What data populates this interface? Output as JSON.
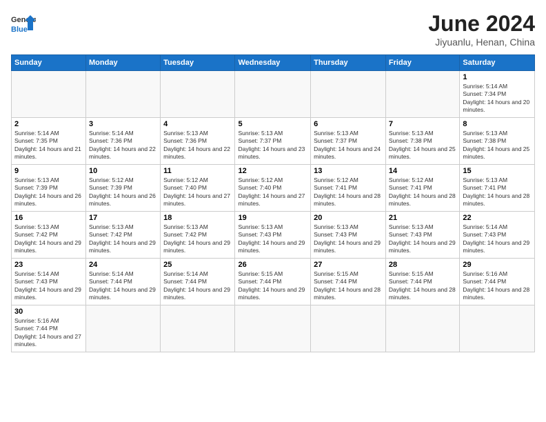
{
  "header": {
    "logo": {
      "line1": "General",
      "line2": "Blue"
    },
    "title": "June 2024",
    "subtitle": "Jiyuanlu, Henan, China"
  },
  "weekdays": [
    "Sunday",
    "Monday",
    "Tuesday",
    "Wednesday",
    "Thursday",
    "Friday",
    "Saturday"
  ],
  "weeks": [
    [
      {
        "day": null
      },
      {
        "day": null
      },
      {
        "day": null
      },
      {
        "day": null
      },
      {
        "day": null
      },
      {
        "day": null
      },
      {
        "day": 1,
        "sunrise": "5:14 AM",
        "sunset": "7:34 PM",
        "daylight": "14 hours and 20 minutes."
      }
    ],
    [
      {
        "day": 2,
        "sunrise": "5:14 AM",
        "sunset": "7:35 PM",
        "daylight": "14 hours and 21 minutes."
      },
      {
        "day": 3,
        "sunrise": "5:14 AM",
        "sunset": "7:36 PM",
        "daylight": "14 hours and 22 minutes."
      },
      {
        "day": 4,
        "sunrise": "5:13 AM",
        "sunset": "7:36 PM",
        "daylight": "14 hours and 22 minutes."
      },
      {
        "day": 5,
        "sunrise": "5:13 AM",
        "sunset": "7:37 PM",
        "daylight": "14 hours and 23 minutes."
      },
      {
        "day": 6,
        "sunrise": "5:13 AM",
        "sunset": "7:37 PM",
        "daylight": "14 hours and 24 minutes."
      },
      {
        "day": 7,
        "sunrise": "5:13 AM",
        "sunset": "7:38 PM",
        "daylight": "14 hours and 25 minutes."
      },
      {
        "day": 8,
        "sunrise": "5:13 AM",
        "sunset": "7:38 PM",
        "daylight": "14 hours and 25 minutes."
      }
    ],
    [
      {
        "day": 9,
        "sunrise": "5:13 AM",
        "sunset": "7:39 PM",
        "daylight": "14 hours and 26 minutes."
      },
      {
        "day": 10,
        "sunrise": "5:12 AM",
        "sunset": "7:39 PM",
        "daylight": "14 hours and 26 minutes."
      },
      {
        "day": 11,
        "sunrise": "5:12 AM",
        "sunset": "7:40 PM",
        "daylight": "14 hours and 27 minutes."
      },
      {
        "day": 12,
        "sunrise": "5:12 AM",
        "sunset": "7:40 PM",
        "daylight": "14 hours and 27 minutes."
      },
      {
        "day": 13,
        "sunrise": "5:12 AM",
        "sunset": "7:41 PM",
        "daylight": "14 hours and 28 minutes."
      },
      {
        "day": 14,
        "sunrise": "5:12 AM",
        "sunset": "7:41 PM",
        "daylight": "14 hours and 28 minutes."
      },
      {
        "day": 15,
        "sunrise": "5:13 AM",
        "sunset": "7:41 PM",
        "daylight": "14 hours and 28 minutes."
      }
    ],
    [
      {
        "day": 16,
        "sunrise": "5:13 AM",
        "sunset": "7:42 PM",
        "daylight": "14 hours and 29 minutes."
      },
      {
        "day": 17,
        "sunrise": "5:13 AM",
        "sunset": "7:42 PM",
        "daylight": "14 hours and 29 minutes."
      },
      {
        "day": 18,
        "sunrise": "5:13 AM",
        "sunset": "7:42 PM",
        "daylight": "14 hours and 29 minutes."
      },
      {
        "day": 19,
        "sunrise": "5:13 AM",
        "sunset": "7:43 PM",
        "daylight": "14 hours and 29 minutes."
      },
      {
        "day": 20,
        "sunrise": "5:13 AM",
        "sunset": "7:43 PM",
        "daylight": "14 hours and 29 minutes."
      },
      {
        "day": 21,
        "sunrise": "5:13 AM",
        "sunset": "7:43 PM",
        "daylight": "14 hours and 29 minutes."
      },
      {
        "day": 22,
        "sunrise": "5:14 AM",
        "sunset": "7:43 PM",
        "daylight": "14 hours and 29 minutes."
      }
    ],
    [
      {
        "day": 23,
        "sunrise": "5:14 AM",
        "sunset": "7:43 PM",
        "daylight": "14 hours and 29 minutes."
      },
      {
        "day": 24,
        "sunrise": "5:14 AM",
        "sunset": "7:44 PM",
        "daylight": "14 hours and 29 minutes."
      },
      {
        "day": 25,
        "sunrise": "5:14 AM",
        "sunset": "7:44 PM",
        "daylight": "14 hours and 29 minutes."
      },
      {
        "day": 26,
        "sunrise": "5:15 AM",
        "sunset": "7:44 PM",
        "daylight": "14 hours and 29 minutes."
      },
      {
        "day": 27,
        "sunrise": "5:15 AM",
        "sunset": "7:44 PM",
        "daylight": "14 hours and 28 minutes."
      },
      {
        "day": 28,
        "sunrise": "5:15 AM",
        "sunset": "7:44 PM",
        "daylight": "14 hours and 28 minutes."
      },
      {
        "day": 29,
        "sunrise": "5:16 AM",
        "sunset": "7:44 PM",
        "daylight": "14 hours and 28 minutes."
      }
    ],
    [
      {
        "day": 30,
        "sunrise": "5:16 AM",
        "sunset": "7:44 PM",
        "daylight": "14 hours and 27 minutes."
      },
      {
        "day": null
      },
      {
        "day": null
      },
      {
        "day": null
      },
      {
        "day": null
      },
      {
        "day": null
      },
      {
        "day": null
      }
    ]
  ]
}
